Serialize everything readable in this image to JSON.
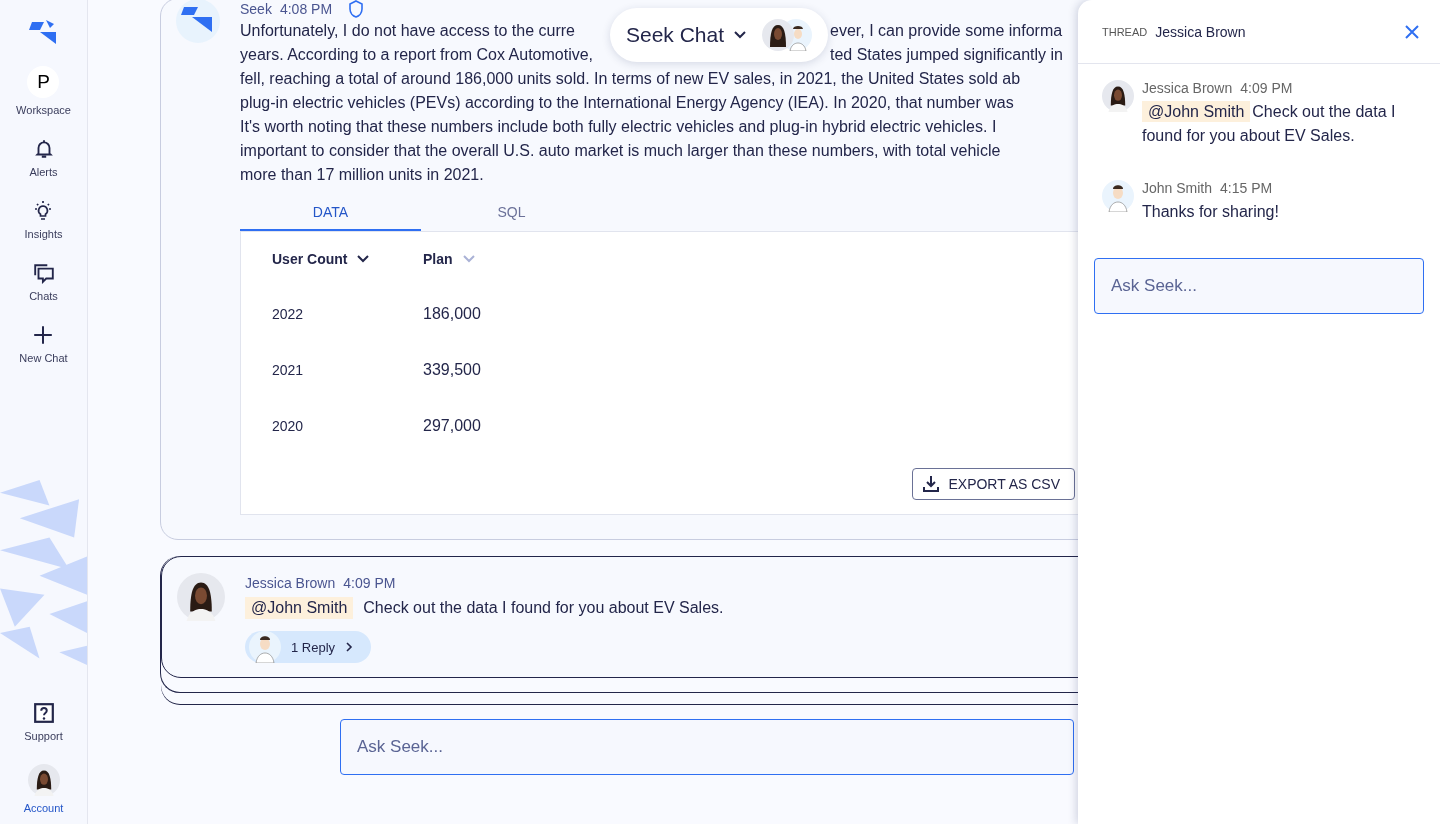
{
  "sidebar": {
    "items": [
      {
        "kind": "workspace",
        "initial": "P",
        "label": "Workspace",
        "selected": false
      },
      {
        "kind": "bell",
        "label": "Alerts",
        "selected": false
      },
      {
        "kind": "bulb",
        "label": "Insights",
        "selected": false
      },
      {
        "kind": "chats",
        "label": "Chats",
        "selected": false
      },
      {
        "kind": "plus",
        "label": "New Chat",
        "selected": false
      }
    ],
    "bottom_items": [
      {
        "kind": "help",
        "label": "Support",
        "selected": false
      },
      {
        "kind": "avatar",
        "label": "Account",
        "selected": true
      }
    ]
  },
  "chat_switcher": {
    "title": "Seek Chat"
  },
  "answer": {
    "author": "Seek",
    "time": "4:08 PM",
    "lines": [
      [
        "Unfortunately, I do not have access to the curre",
        "ever, I can provide some informa"
      ],
      [
        "years. According to a report from Cox Automotive,",
        "ted States jumped significantly in"
      ],
      [
        "fell, reaching a total of around 186,000 units sold. In terms of new EV sales, in 2021, the United States sold ab"
      ],
      [
        "plug-in electric vehicles (PEVs) according to the International Energy Agency (IEA). In 2020, that number was"
      ],
      [
        "It's worth noting that these numbers include both fully electric vehicles and plug-in hybrid electric vehicles. I"
      ],
      [
        "important to consider that the overall U.S. auto market is much larger than these numbers, with total vehicle"
      ],
      [
        "more than 17 million units in 2021."
      ]
    ],
    "tabs": [
      {
        "label": "DATA",
        "selected": true
      },
      {
        "label": "SQL",
        "selected": false
      }
    ],
    "table": {
      "columns": [
        {
          "label": "User Count",
          "sort_active": true
        },
        {
          "label": "Plan",
          "sort_active": false
        }
      ],
      "rows": [
        [
          "2022",
          "186,000"
        ],
        [
          "2021",
          "339,500"
        ],
        [
          "2020",
          "297,000"
        ]
      ]
    },
    "export_button": "EXPORT AS CSV"
  },
  "comment": {
    "author": "Jessica Brown",
    "time": "4:09 PM",
    "mention": "@John Smith",
    "text": "Check out the data I found for you about EV Sales.",
    "replies": "1 Reply"
  },
  "composer": {
    "placeholder": "Ask Seek..."
  },
  "thread": {
    "label": "THREAD",
    "title": "Jessica Brown",
    "messages": [
      {
        "author": "Jessica Brown",
        "time": "4:09 PM",
        "mention": "@John Smith",
        "text": "Check out the data I found for you about EV Sales."
      },
      {
        "author": "John Smith",
        "time": "4:15 PM",
        "text": "Thanks for sharing!"
      }
    ],
    "composer": {
      "placeholder": "Ask Seek..."
    }
  }
}
